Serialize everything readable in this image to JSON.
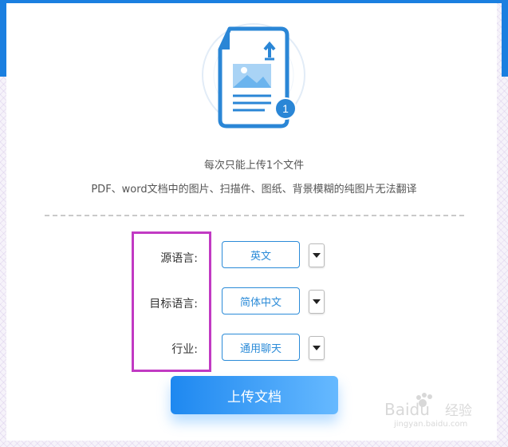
{
  "info": {
    "line1": "每次只能上传1个文件",
    "line2": "PDF、word文档中的图片、扫描件、图纸、背景模糊的纯图片无法翻译"
  },
  "illustration": {
    "badge": "1",
    "icon": "document-upload-icon"
  },
  "form": {
    "rows": [
      {
        "label": "源语言:",
        "value": "英文"
      },
      {
        "label": "目标语言:",
        "value": "简体中文"
      },
      {
        "label": "行业:",
        "value": "通用聊天"
      }
    ]
  },
  "upload_button": "上传文档",
  "watermark": {
    "brand": "Baidu",
    "cn": "经验",
    "url": "jingyan.baidu.com"
  },
  "colors": {
    "accent": "#1a7fe0",
    "highlight": "#c13ac3"
  }
}
